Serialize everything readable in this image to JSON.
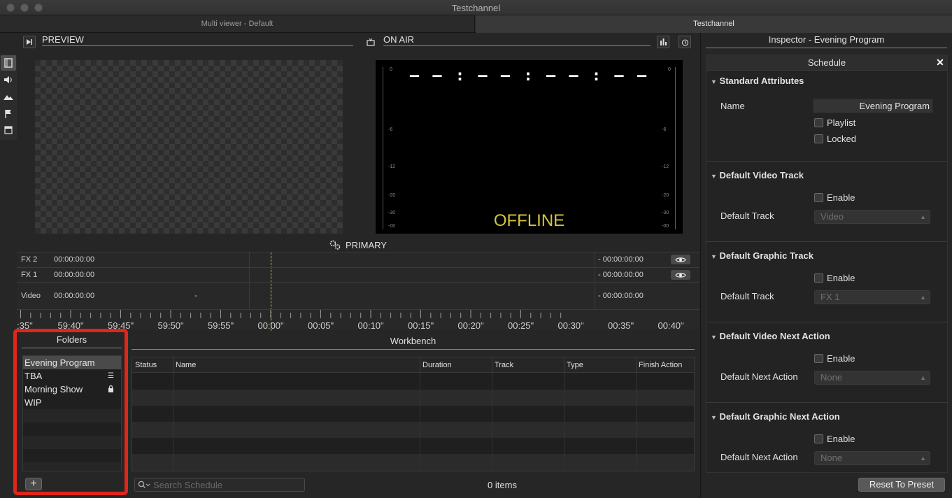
{
  "window": {
    "title": "Testchannel"
  },
  "tabs": [
    {
      "label": "Multi viewer - Default"
    },
    {
      "label": "Testchannel"
    }
  ],
  "preview": {
    "title": "PREVIEW"
  },
  "onair": {
    "title": "ON AIR",
    "timecode": "– – : – – : – – : – –",
    "status": "OFFLINE",
    "meter_ticks": [
      "0",
      "-6",
      "-12",
      "-20",
      "-30",
      "-00"
    ]
  },
  "primary": {
    "label": "PRIMARY"
  },
  "timeline": {
    "rows": [
      {
        "label": "FX 2",
        "time": "00:00:00:00",
        "mid": "",
        "remaining": "- 00:00:00:00",
        "eye": true
      },
      {
        "label": "FX 1",
        "time": "00:00:00:00",
        "mid": "",
        "remaining": "- 00:00:00:00",
        "eye": true
      },
      {
        "label": "Video",
        "time": "00:00:00:00",
        "mid": "-",
        "remaining": "- 00:00:00:00",
        "eye": false
      }
    ],
    "ruler": [
      ":35\"",
      "59:40\"",
      "59:45\"",
      "59:50\"",
      "59:55\"",
      "00:00\"",
      "00:05\"",
      "00:10\"",
      "00:15\"",
      "00:20\"",
      "00:25\"",
      "00:30\"",
      "00:35\"",
      "00:40\""
    ]
  },
  "folders": {
    "title": "Folders",
    "items": [
      {
        "label": "Evening Program",
        "badge": "",
        "selected": true
      },
      {
        "label": "TBA",
        "badge": "list",
        "selected": false
      },
      {
        "label": "Morning Show",
        "badge": "lock",
        "selected": false
      },
      {
        "label": "WIP",
        "badge": "",
        "selected": false
      }
    ],
    "add_label": "+"
  },
  "workbench": {
    "title": "Workbench",
    "columns": [
      "Status",
      "Name",
      "Duration",
      "Track",
      "Type",
      "Finish Action"
    ],
    "search_placeholder": "Search Schedule",
    "count": "0 items"
  },
  "inspector": {
    "title": "Inspector - Evening Program",
    "panel_title": "Schedule",
    "close": "✕",
    "standard": {
      "title": "Standard Attributes",
      "name_label": "Name",
      "name_value": "Evening Program",
      "playlist_label": "Playlist",
      "locked_label": "Locked"
    },
    "video_track": {
      "title": "Default Video Track",
      "enable_label": "Enable",
      "track_label": "Default Track",
      "track_value": "Video"
    },
    "graphic_track": {
      "title": "Default Graphic Track",
      "enable_label": "Enable",
      "track_label": "Default Track",
      "track_value": "FX 1"
    },
    "video_next": {
      "title": "Default Video Next Action",
      "enable_label": "Enable",
      "action_label": "Default Next Action",
      "action_value": "None"
    },
    "graphic_next": {
      "title": "Default Graphic Next Action",
      "enable_label": "Enable",
      "action_label": "Default Next Action",
      "action_value": "None"
    },
    "reset_label": "Reset To Preset"
  },
  "colors": {
    "accent_offline": "#d6c33a",
    "highlight": "#e0251b",
    "playhead": "#c8c83a"
  }
}
